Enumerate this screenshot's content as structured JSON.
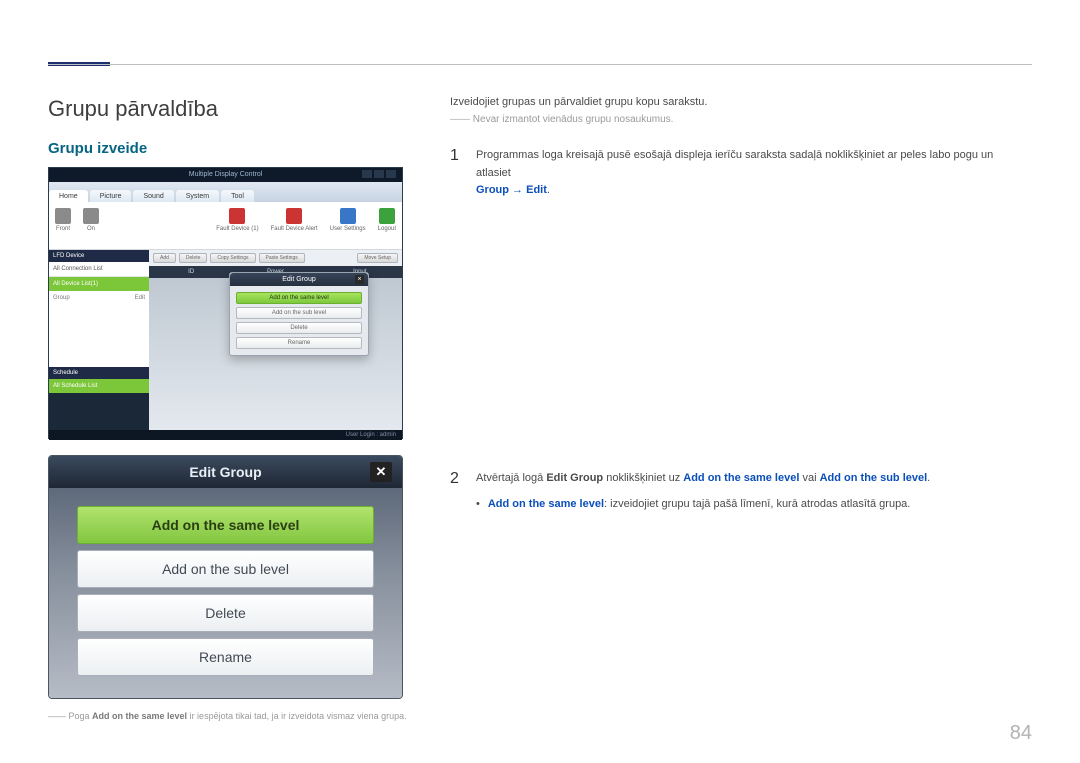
{
  "pageNumber": "84",
  "title": "Grupu pārvaldība",
  "subhead": "Grupu izveide",
  "mdc": {
    "windowTitle": "Multiple Display Control",
    "tabs": [
      "Home",
      "Picture",
      "Sound",
      "System",
      "Tool"
    ],
    "toolbarLeft": [
      {
        "label": "Front",
        "icon": "ico-gray"
      },
      {
        "label": "On",
        "icon": "ico-gray"
      }
    ],
    "toolbarRight": [
      {
        "label": "Fault Device (1)",
        "icon": "ico-red"
      },
      {
        "label": "Fault Device Alert",
        "icon": "ico-red"
      },
      {
        "label": "User Settings",
        "icon": "ico-blue"
      },
      {
        "label": "Logout",
        "icon": "ico-green"
      }
    ],
    "sideLfd": "LFD Device",
    "sideAllConn": "All Connection List",
    "sideSelected": "All Device List(1)",
    "sideGroup": "Group",
    "sideEdit": "Edit",
    "sideSchedule": "Schedule",
    "sideAllSched": "All Schedule List",
    "btnRow": [
      "Add",
      "Delete",
      "Copy Settings",
      "Paste Settings",
      "Move Setup"
    ],
    "cols": [
      "ID",
      "Power",
      "Input"
    ],
    "editGroupTitle": "Edit Group",
    "editGroupBtns": [
      "Add on the same level",
      "Add on the sub level",
      "Delete",
      "Rename"
    ],
    "footer": "User Login : admin"
  },
  "eg2": {
    "title": "Edit Group",
    "btns": [
      "Add on the same level",
      "Add on the sub level",
      "Delete",
      "Rename"
    ]
  },
  "footnote": {
    "prefix": "――  Poga ",
    "bold": "Add on the same level",
    "rest": " ir iespējota tikai tad, ja ir izveidota vismaz viena grupa."
  },
  "right": {
    "intro": "Izveidojiet grupas un pārvaldiet grupu kopu sarakstu.",
    "noteDash": "――",
    "note": "Nevar izmantot vienādus grupu nosaukumus.",
    "step1": {
      "num": "1",
      "text": "Programmas loga kreisajā pusē esošajā displeja ierīču saraksta sadaļā noklikšķiniet ar peles labo pogu un atlasiet ",
      "link": "Group → Edit",
      "suffix": "."
    },
    "step2": {
      "num": "2",
      "t1": "Atvērtajā logā ",
      "b1": "Edit Group",
      "t2": " noklikšķiniet uz ",
      "l1": "Add on the same level",
      "t3": " vai ",
      "l2": "Add on the sub level",
      "t4": "."
    },
    "bullet": {
      "l": "Add on the same level",
      "t": ": izveidojiet grupu tajā pašā līmenī, kurā atrodas atlasītā grupa."
    }
  }
}
